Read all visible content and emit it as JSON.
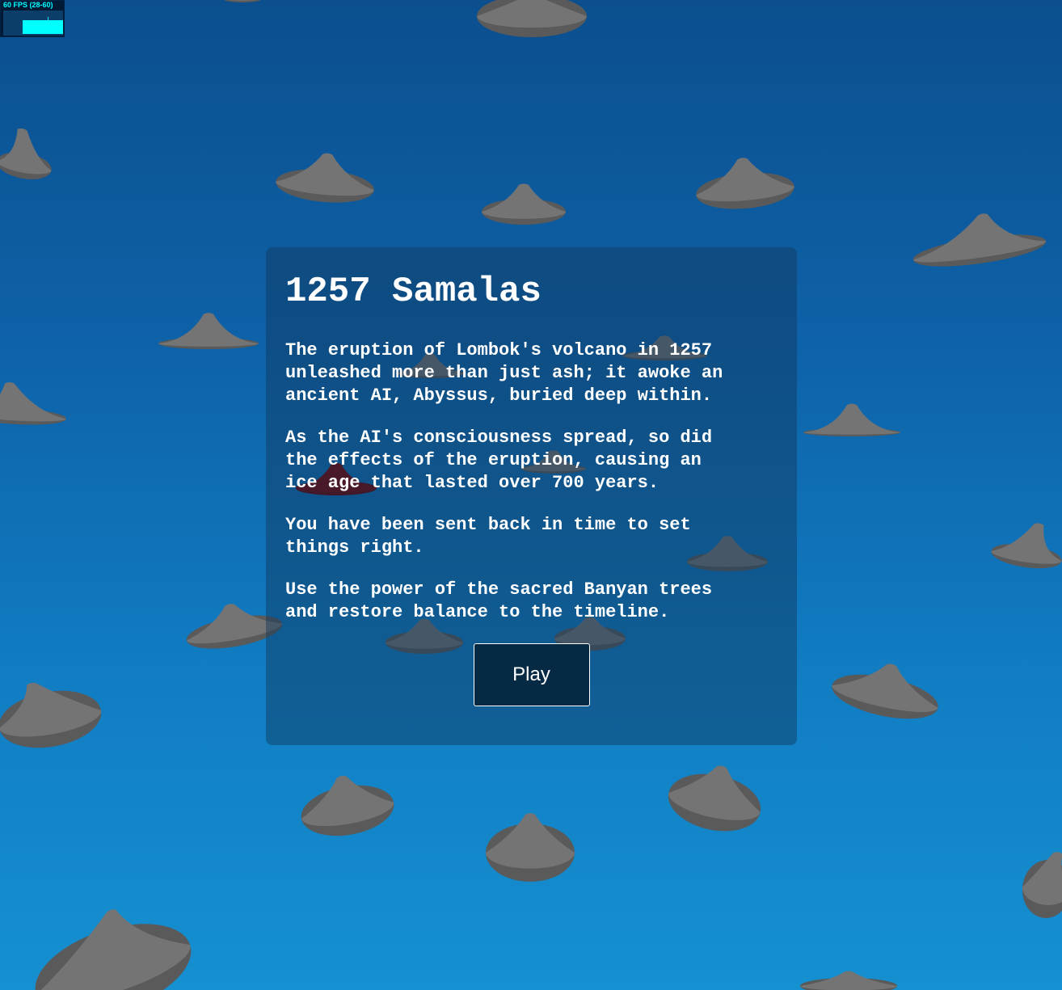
{
  "fps": {
    "label": "60 FPS (28-60)"
  },
  "intro": {
    "title": "1257 Samalas",
    "paragraphs": [
      "The eruption of Lombok's volcano in 1257\nunleashed more than just ash; it awoke an\nancient AI, Abyssus, buried deep within.",
      "As the AI's consciousness spread, so did\nthe effects of the eruption, causing an\nice age that lasted over 700 years.",
      "You have been sent back in time to set\nthings right.",
      "Use the power of the sacred Banyan trees\nand restore balance to the timeline."
    ],
    "play_label": "Play"
  },
  "colors": {
    "ocean_top": "#0b4f8e",
    "ocean_bottom": "#1590d0",
    "rock": "#6b6b6b",
    "rock_dark": "#5a5a5a",
    "active_volcano": "#6b0000"
  },
  "scene": {
    "objects": [
      "rock-cone",
      "active-volcano-cone"
    ]
  }
}
